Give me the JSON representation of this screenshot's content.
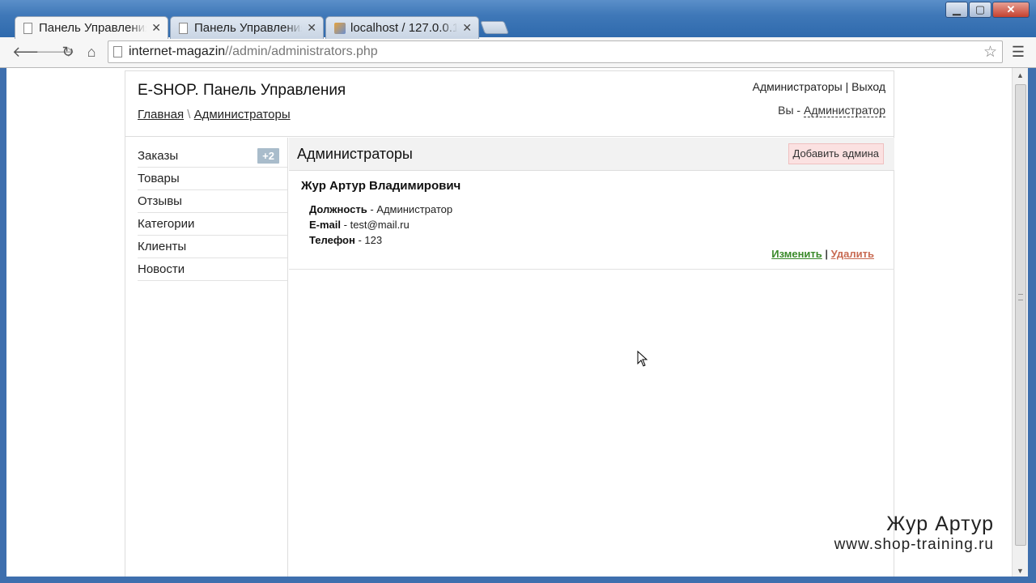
{
  "browser": {
    "tabs": [
      {
        "title": "Панель Управления",
        "active": true
      },
      {
        "title": "Панель Управления",
        "active": false
      },
      {
        "title": "localhost / 127.0.0.1",
        "active": false
      }
    ],
    "url_host": "internet-magazin",
    "url_path": "//admin/administrators.php"
  },
  "header": {
    "site_title": "E-SHOP. Панель Управления",
    "breadcrumb": [
      "Главная",
      "Администраторы"
    ],
    "breadcrumb_sep": " \\ ",
    "top_links": [
      "Администраторы",
      "Выход"
    ],
    "top_links_sep": " | ",
    "user_prefix": "Вы - ",
    "user_role": "Администратор"
  },
  "sidebar": {
    "items": [
      {
        "label": "Заказы",
        "badge": "+2"
      },
      {
        "label": "Товары"
      },
      {
        "label": "Отзывы"
      },
      {
        "label": "Категории"
      },
      {
        "label": "Клиенты"
      },
      {
        "label": "Новости"
      }
    ]
  },
  "content": {
    "title": "Администраторы",
    "add_button": "Добавить админа",
    "admins": [
      {
        "name": "Жур Артур Владимирович",
        "position_label": "Должность",
        "position": "Администратор",
        "email_label": "E-mail",
        "email": "test@mail.ru",
        "phone_label": "Телефон",
        "phone": "123",
        "edit_label": "Изменить",
        "delete_label": "Удалить"
      }
    ]
  },
  "watermark": {
    "name": "Жур Артур",
    "site": "www.shop-training.ru"
  }
}
